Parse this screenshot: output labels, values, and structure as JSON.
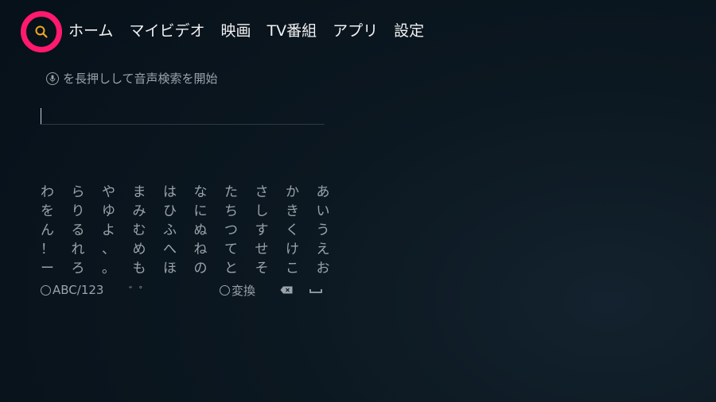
{
  "nav": {
    "items": [
      {
        "label": "ホーム"
      },
      {
        "label": "マイビデオ"
      },
      {
        "label": "映画"
      },
      {
        "label": "TV番組"
      },
      {
        "label": "アプリ"
      },
      {
        "label": "設定"
      }
    ]
  },
  "colors": {
    "focus_ring": "#ff1a6e",
    "search_icon": "#f5a623",
    "text_dim": "#9aa3aa"
  },
  "search": {
    "voice_hint": "を長押しして音声検索を開始",
    "value": ""
  },
  "keyboard": {
    "rows": [
      [
        "わ",
        "ら",
        "や",
        "ま",
        "は",
        "な",
        "た",
        "さ",
        "か",
        "あ"
      ],
      [
        "を",
        "り",
        "ゆ",
        "み",
        "ひ",
        "に",
        "ち",
        "し",
        "き",
        "い"
      ],
      [
        "ん",
        "る",
        "よ",
        "む",
        "ふ",
        "ぬ",
        "つ",
        "す",
        "く",
        "う"
      ],
      [
        "！",
        "れ",
        "、",
        "め",
        "へ",
        "ね",
        "て",
        "せ",
        "け",
        "え"
      ],
      [
        "ー",
        "ろ",
        "。",
        "も",
        "ほ",
        "の",
        "と",
        "そ",
        "こ",
        "お"
      ]
    ],
    "mode_label": "ABC/123",
    "dakuten_label": "゛゜",
    "convert_label": "変換"
  }
}
